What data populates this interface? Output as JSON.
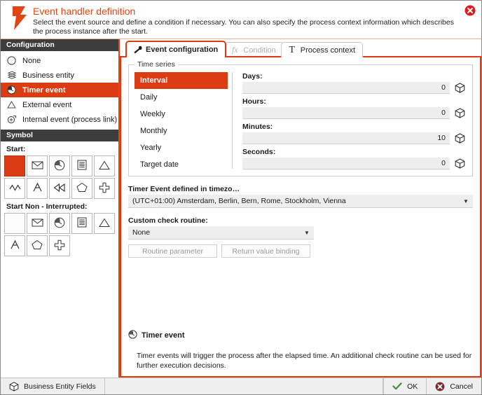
{
  "header": {
    "icon": "lightning-bolt-icon",
    "title": "Event handler definition",
    "description": "Select the event source and define a condition if necessary. You can also specify the process context information which describes the process instance after the start.",
    "close_icon": "close-icon"
  },
  "accent_color": "#DC3C14",
  "sidebar": {
    "configuration_header": "Configuration",
    "items": [
      {
        "label": "None",
        "icon": "circle-icon",
        "selected": false
      },
      {
        "label": "Business entity",
        "icon": "business-entity-icon",
        "selected": false
      },
      {
        "label": "Timer event",
        "icon": "clock-icon",
        "selected": true
      },
      {
        "label": "External event",
        "icon": "triangle-icon",
        "selected": false
      },
      {
        "label": "Internal event (process link)",
        "icon": "process-link-icon",
        "selected": false
      }
    ],
    "symbol_header": "Symbol",
    "start_label": "Start:",
    "start_symbols": [
      {
        "icon": "filled-square-icon",
        "selected": true
      },
      {
        "icon": "envelope-icon",
        "selected": false
      },
      {
        "icon": "clock-icon",
        "selected": false
      },
      {
        "icon": "document-icon",
        "selected": false
      },
      {
        "icon": "triangle-icon",
        "selected": false
      },
      {
        "icon": "signal-icon",
        "selected": false
      },
      {
        "icon": "escalation-icon",
        "selected": false
      },
      {
        "icon": "rewind-icon",
        "selected": false
      },
      {
        "icon": "pentagon-icon",
        "selected": false
      },
      {
        "icon": "plus-cross-icon",
        "selected": false
      }
    ],
    "start_non_interrupted_label": "Start Non - Interrupted:",
    "start_non_interrupted_symbols": [
      {
        "icon": "blank-icon",
        "selected": false
      },
      {
        "icon": "envelope-icon",
        "selected": false
      },
      {
        "icon": "clock-icon",
        "selected": false
      },
      {
        "icon": "document-icon",
        "selected": false
      },
      {
        "icon": "triangle-icon",
        "selected": false
      },
      {
        "icon": "escalation-icon",
        "selected": false
      },
      {
        "icon": "pentagon-icon",
        "selected": false
      },
      {
        "icon": "plus-cross-icon",
        "selected": false
      }
    ]
  },
  "tabs": [
    {
      "label": "Event configuration",
      "icon": "wrench-icon",
      "active": true,
      "disabled": false
    },
    {
      "label": "Condition",
      "icon": "fx-icon",
      "active": false,
      "disabled": true
    },
    {
      "label": "Process context",
      "icon": "text-t-icon",
      "active": false,
      "disabled": false
    }
  ],
  "panel": {
    "time_series": {
      "legend": "Time series",
      "items": [
        {
          "label": "Interval",
          "selected": true
        },
        {
          "label": "Daily",
          "selected": false
        },
        {
          "label": "Weekly",
          "selected": false
        },
        {
          "label": "Monthly",
          "selected": false
        },
        {
          "label": "Yearly",
          "selected": false
        },
        {
          "label": "Target date",
          "selected": false
        }
      ],
      "fields": [
        {
          "label": "Days:",
          "value": "0",
          "button_icon": "cube-icon"
        },
        {
          "label": "Hours:",
          "value": "0",
          "button_icon": "cube-icon"
        },
        {
          "label": "Minutes:",
          "value": "10",
          "button_icon": "cube-icon"
        },
        {
          "label": "Seconds:",
          "value": "0",
          "button_icon": "cube-icon"
        }
      ]
    },
    "timezone": {
      "label": "Timer Event defined in timezo…",
      "value": "(UTC+01:00) Amsterdam, Berlin, Bern, Rome, Stockholm, Vienna",
      "arrow_icon": "chevron-down-icon"
    },
    "custom_check_routine": {
      "label": "Custom check routine:",
      "value": "None",
      "arrow_icon": "chevron-down-icon",
      "buttons": [
        {
          "label": "Routine parameter",
          "disabled": true
        },
        {
          "label": "Return value binding",
          "disabled": true
        }
      ]
    },
    "info": {
      "icon": "clock-icon",
      "title": "Timer event",
      "text": "Timer events will trigger the process after the elapsed time. An additional check routine can be used for further execution decisions."
    }
  },
  "footer": {
    "business_entity_fields": {
      "label": "Business Entity Fields",
      "icon": "cube-icon"
    },
    "ok": {
      "label": "OK",
      "icon": "check-icon",
      "color": "#4C8C3F"
    },
    "cancel": {
      "label": "Cancel",
      "icon": "cancel-circle-icon",
      "color": "#7A2E33"
    }
  }
}
